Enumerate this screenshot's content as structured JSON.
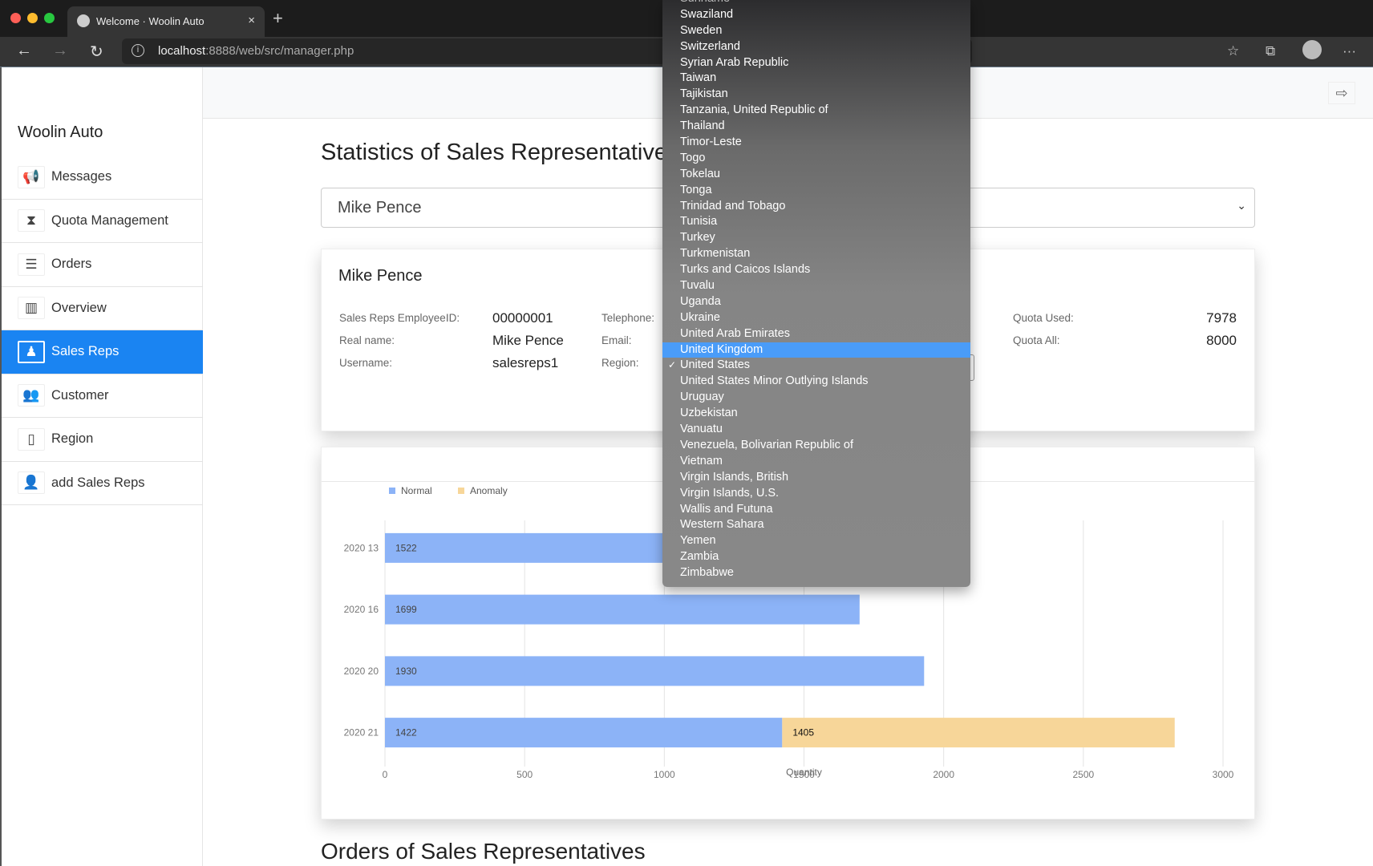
{
  "browser": {
    "tab_title": "Welcome · Woolin Auto",
    "url_host": "localhost",
    "url_rest": ":8888/web/src/manager.php"
  },
  "sidebar": {
    "brand": "Woolin Auto",
    "items": [
      {
        "label": "Messages",
        "icon": "megaphone-icon",
        "glyph": "📢"
      },
      {
        "label": "Quota Management",
        "icon": "hourglass-icon",
        "glyph": "⧗"
      },
      {
        "label": "Orders",
        "icon": "list-icon",
        "glyph": "☰"
      },
      {
        "label": "Overview",
        "icon": "bar-chart-icon",
        "glyph": "▥"
      },
      {
        "label": "Sales Reps",
        "icon": "user-secret-icon",
        "glyph": "♟",
        "active": true
      },
      {
        "label": "Customer",
        "icon": "users-icon",
        "glyph": "👥"
      },
      {
        "label": "Region",
        "icon": "map-icon",
        "glyph": "▯"
      },
      {
        "label": "add Sales Reps",
        "icon": "user-plus-icon",
        "glyph": "👤"
      }
    ]
  },
  "main": {
    "title": "Statistics of Sales Representatives",
    "selected_rep": "Mike Pence",
    "section2_title": "Orders of Sales Representatives"
  },
  "rep": {
    "name": "Mike Pence",
    "fields": {
      "employee_id_label": "Sales Reps EmployeeID:",
      "employee_id": "00000001",
      "real_name_label": "Real name:",
      "real_name": "Mike Pence",
      "username_label": "Username:",
      "username": "salesreps1",
      "telephone_label": "Telephone:",
      "email_label": "Email:",
      "region_label": "Region:",
      "quota_used_label": "Quota Used:",
      "quota_used": "7978",
      "quota_all_label": "Quota All:",
      "quota_all": "8000"
    }
  },
  "region_dropdown": {
    "selected": "United States",
    "highlighted": "United Kingdom",
    "options": [
      "Suriname",
      "Swaziland",
      "Sweden",
      "Switzerland",
      "Syrian Arab Republic",
      "Taiwan",
      "Tajikistan",
      "Tanzania, United Republic of",
      "Thailand",
      "Timor-Leste",
      "Togo",
      "Tokelau",
      "Tonga",
      "Trinidad and Tobago",
      "Tunisia",
      "Turkey",
      "Turkmenistan",
      "Turks and Caicos Islands",
      "Tuvalu",
      "Uganda",
      "Ukraine",
      "United Arab Emirates",
      "United Kingdom",
      "United States",
      "United States Minor Outlying Islands",
      "Uruguay",
      "Uzbekistan",
      "Vanuatu",
      "Venezuela, Bolivarian Republic of",
      "Vietnam",
      "Virgin Islands, British",
      "Virgin Islands, U.S.",
      "Wallis and Futuna",
      "Western Sahara",
      "Yemen",
      "Zambia",
      "Zimbabwe"
    ]
  },
  "chart_data": {
    "type": "bar",
    "orientation": "horizontal",
    "stacked": true,
    "categories": [
      "2020 13",
      "2020 16",
      "2020 20",
      "2020 21"
    ],
    "series": [
      {
        "name": "Normal",
        "values": [
          1522,
          1699,
          1930,
          1422
        ],
        "color": "#8cb3f7"
      },
      {
        "name": "Anomaly",
        "values": [
          0,
          0,
          0,
          1405
        ],
        "color": "#f7d699"
      }
    ],
    "xlabel": "Quantity",
    "xlim": [
      0,
      3000
    ],
    "xticks": [
      0,
      500,
      1000,
      1500,
      2000,
      2500,
      3000
    ],
    "grid": true,
    "legend": "top-left"
  }
}
